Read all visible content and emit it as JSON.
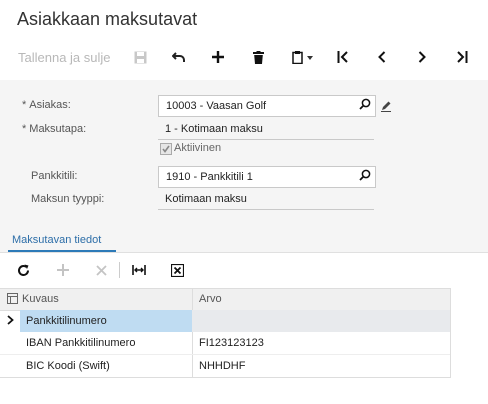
{
  "header": {
    "title": "Asiakkaan maksutavat"
  },
  "toolbar": {
    "save_close_label": "Tallenna ja sulje"
  },
  "form": {
    "customer": {
      "label": "Asiakas:",
      "value": "10003 - Vaasan Golf",
      "required": "*"
    },
    "payment_method": {
      "label": "Maksutapa:",
      "value": "1 - Kotimaan maksu",
      "required": "*"
    },
    "active": {
      "label": "Aktiivinen",
      "checked": true
    },
    "bank_account": {
      "label": "Pankkitili:",
      "value": "1910 - Pankkitili 1"
    },
    "payment_type": {
      "label": "Maksun tyyppi:",
      "value": "Kotimaan maksu"
    }
  },
  "tabs": [
    {
      "label": "Maksutavan tiedot"
    }
  ],
  "grid": {
    "columns": [
      "Kuvaus",
      "Arvo"
    ],
    "rows": [
      {
        "desc": "Pankkitilinumero",
        "value": ""
      },
      {
        "desc": "IBAN Pankkitilinumero",
        "value": "FI123123123"
      },
      {
        "desc": "BIC Koodi (Swift)",
        "value": "NHHDHF"
      }
    ]
  },
  "colors": {
    "accent": "#2d7ab8",
    "selected_row": "#bfdcf2",
    "form_bg": "#f5f5f5"
  }
}
